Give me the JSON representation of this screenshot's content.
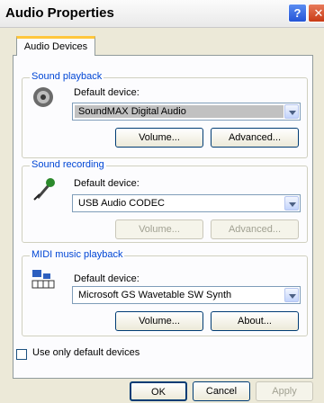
{
  "window": {
    "title": "Audio Properties",
    "help_label": "?",
    "close_label": "✕"
  },
  "tabs": [
    {
      "label": "Audio Devices"
    }
  ],
  "sound_playback": {
    "legend": "Sound playback",
    "default_label": "Default device:",
    "device": "SoundMAX Digital Audio",
    "volume_label": "Volume...",
    "advanced_label": "Advanced..."
  },
  "sound_recording": {
    "legend": "Sound recording",
    "default_label": "Default device:",
    "device": "USB Audio CODEC",
    "volume_label": "Volume...",
    "advanced_label": "Advanced..."
  },
  "midi": {
    "legend": "MIDI music playback",
    "default_label": "Default device:",
    "device": "Microsoft GS Wavetable SW Synth",
    "volume_label": "Volume...",
    "about_label": "About..."
  },
  "use_default_label": "Use only default devices",
  "footer": {
    "ok_label": "OK",
    "cancel_label": "Cancel",
    "apply_label": "Apply"
  }
}
